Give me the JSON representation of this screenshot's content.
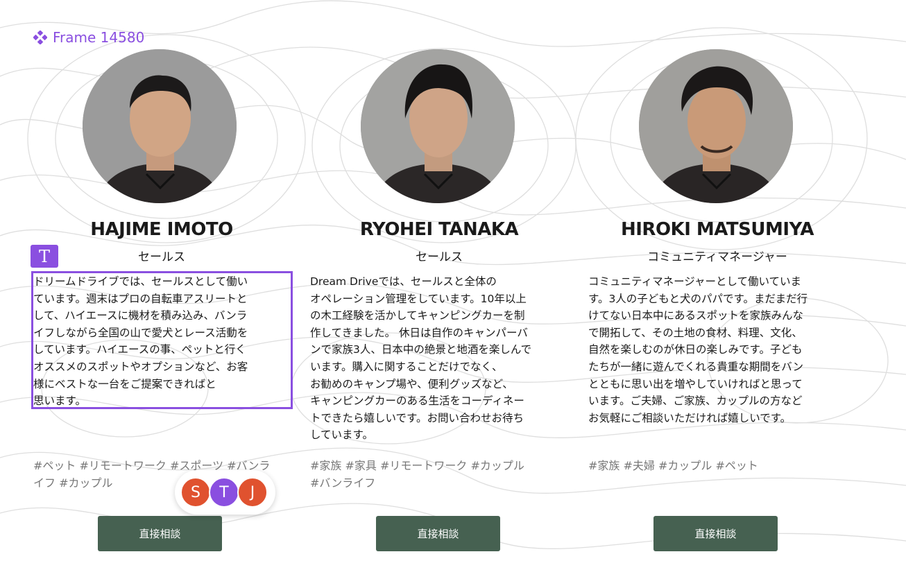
{
  "frame": {
    "label": "Frame 14580",
    "accent_color": "#8a4fe0"
  },
  "staff": [
    {
      "name": "HAJIME IMOTO",
      "role": "セールス",
      "bio": "ドリームドライブでは、セールスとして働い\nています。週末はプロの自転車アスリートと\nして、ハイエースに機材を積み込み、バンラ\nイフしながら全国の山で愛犬とレース活動を\nしています。ハイエースの事、ペットと行く\nオススメのスポットやオプションなど、お客\n様にベストな一台をご提案できればと\n思います。",
      "tags": "#ペット #リモートワーク #スポーツ #バンラ\nイフ #カップル",
      "button": "直接相談"
    },
    {
      "name": "RYOHEI TANAKA",
      "role": "セールス",
      "bio": "Dream Driveでは、セールスと全体の\nオペレーション管理をしています。10年以上\nの木工経験を活かしてキャンピングカーを制\n作してきました。 休日は自作のキャンパーバ\nンで家族3人、日本中の絶景と地酒を楽しんで\nいます。購入に関することだけでなく、\nお勧めのキャンプ場や、便利グッズなど、\nキャンピングカーのある生活をコーディネー\nトできたら嬉しいです。お問い合わせお待ち\nしています。",
      "tags": "#家族 #家具 #リモートワーク #カップル\n#バンライフ",
      "button": "直接相談"
    },
    {
      "name": "HIROKI MATSUMIYA",
      "role": "コミュニティマネージャー",
      "bio": "コミュニティマネージャーとして働いていま\nす。3人の子どもと犬のパパです。まだまだ行\nけてない日本中にあるスポットを家族みんな\nで開拓して、その土地の食材、料理、文化、\n自然を楽しむのが休日の楽しみです。子ども\nたちが一緒に遊んでくれる貴重な期間をバン\nとともに思い出を増やしていければと思って\nいます。ご夫婦、ご家族、カップルの方など\nお気軽にご相談いただければ嬉しいです。",
      "tags": "#家族 #夫婦 #カップル #ペット",
      "button": "直接相談"
    }
  ],
  "editor": {
    "text_tool_icon": "T",
    "collaborators": [
      {
        "initial": "S",
        "color": "#e0522f"
      },
      {
        "initial": "T",
        "color": "#8a4fe0"
      },
      {
        "initial": "J",
        "color": "#e0522f"
      }
    ]
  },
  "colors": {
    "button_bg": "#466151",
    "tag_text": "#777777"
  }
}
